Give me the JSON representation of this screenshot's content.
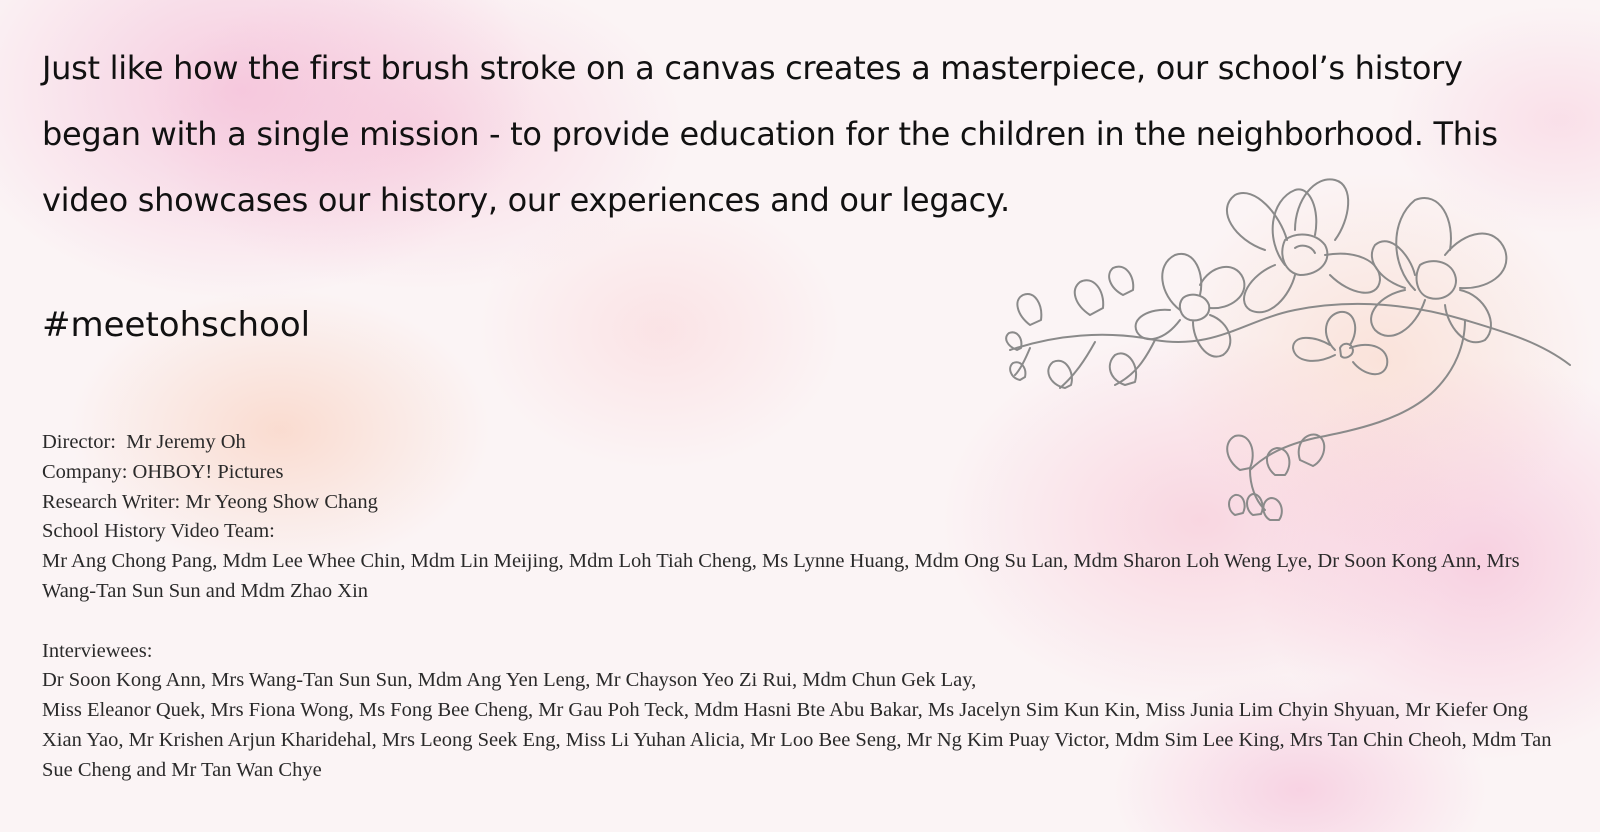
{
  "intro_text": "Just like how the first brush stroke on a canvas creates a masterpiece, our school’s history began with a single mission - to provide education for the children in the neighborhood. This video showcases our history, our experiences and our legacy.",
  "hashtag": "#meetohschool",
  "credits": {
    "director": "Director:  Mr Jeremy Oh",
    "company": "Company: OHBOY! Pictures",
    "research_writer": "Research Writer: Mr Yeong Show Chang",
    "team_heading": "School History Video Team:",
    "team_members": "Mr Ang Chong Pang, Mdm Lee Whee Chin, Mdm Lin Meijing, Mdm Loh Tiah Cheng, Ms Lynne Huang, Mdm Ong Su Lan, Mdm Sharon Loh Weng Lye, Dr Soon Kong Ann, Mrs Wang-Tan Sun Sun and Mdm Zhao Xin",
    "interviewees_heading": "Interviewees:",
    "interviewees_line1": "Dr Soon Kong Ann, Mrs Wang-Tan Sun Sun, Mdm Ang Yen Leng, Mr Chayson Yeo Zi Rui, Mdm Chun Gek Lay,",
    "interviewees_line2": "Miss Eleanor Quek, Mrs Fiona Wong, Ms Fong Bee Cheng, Mr Gau Poh Teck, Mdm Hasni Bte Abu Bakar, Ms Jacelyn Sim Kun Kin, Miss Junia Lim Chyin Shyuan, Mr Kiefer Ong Xian Yao, Mr Krishen Arjun Kharidehal, Mrs Leong Seek Eng, Miss Li Yuhan Alicia, Mr Loo Bee Seng, Mr Ng Kim Puay Victor, Mdm Sim Lee King, Mrs Tan Chin Cheoh, Mdm Tan Sue Cheng and Mr Tan Wan Chye"
  },
  "decoration": {
    "icon": "orchid-branch-icon",
    "line_color": "#8a8a8a",
    "accent_colors": [
      "#f2aacd",
      "#f8c8b2"
    ]
  }
}
